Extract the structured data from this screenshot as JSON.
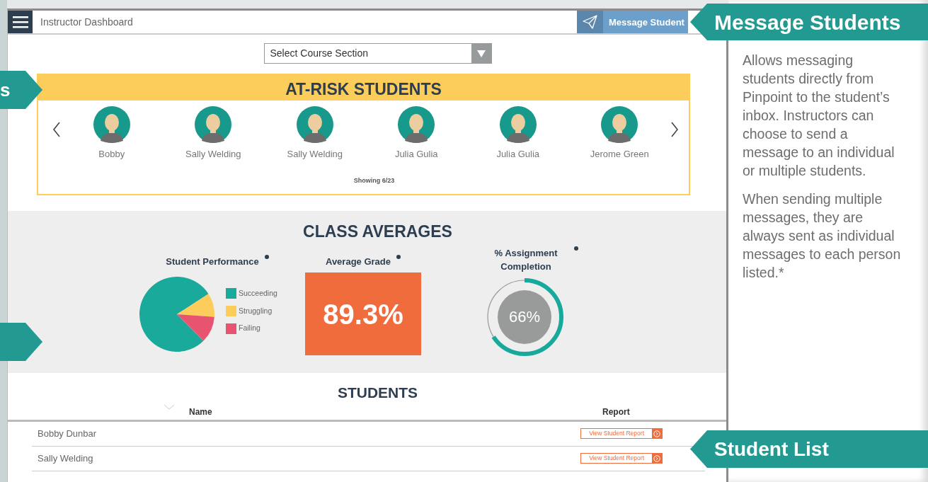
{
  "top_bar": {
    "title": "Instructor Dashboard",
    "message_button": "Message Student"
  },
  "course_select": {
    "label": "Select Course Section"
  },
  "at_risk": {
    "title": "AT-RISK STUDENTS",
    "students": [
      {
        "name": "Bobby"
      },
      {
        "name": "Sally Welding"
      },
      {
        "name": "Sally Welding"
      },
      {
        "name": "Julia Gulia"
      },
      {
        "name": "Julia Gulia"
      },
      {
        "name": "Jerome Green"
      }
    ],
    "showing": "Showing 6/23"
  },
  "class_averages": {
    "title": "CLASS AVERAGES",
    "performance": {
      "title": "Student Performance",
      "legend": [
        {
          "label": "Succeeding",
          "color": "#19aa9c"
        },
        {
          "label": "Struggling",
          "color": "#fdcd5b"
        },
        {
          "label": "Failing",
          "color": "#e8546f"
        }
      ]
    },
    "grade": {
      "title": "Average Grade",
      "value": "89.3%"
    },
    "completion": {
      "title": "% Assignment Completion",
      "value": "66%",
      "level": 0.66
    }
  },
  "students": {
    "title": "STUDENTS",
    "columns": [
      "Name",
      "Report"
    ],
    "rows": [
      {
        "name": "Bobby Dunbar",
        "report": "View Student Report"
      },
      {
        "name": "Sally Welding",
        "report": "View Student Report"
      }
    ]
  },
  "callouts": {
    "message": "Message Students",
    "student_list": "Student List",
    "left_partial": "s"
  },
  "help_panel": {
    "paragraphs": [
      "Allows messaging students directly from Pinpoint to the student’s inbox. Instructors can choose to send a message to an individual or multiple students.",
      "When sending multiple messages, they are always sent as individual messages to each person listed.*"
    ]
  }
}
